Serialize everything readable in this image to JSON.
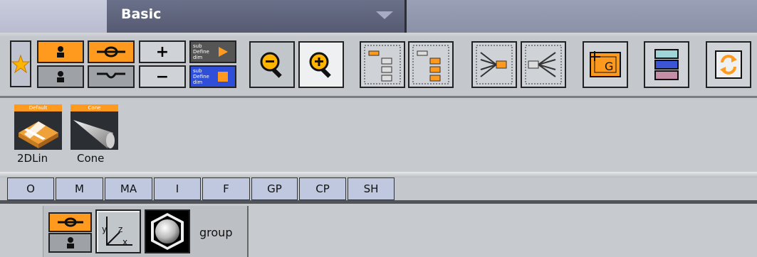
{
  "header": {
    "title": "Basic",
    "dropdown_icon": "chevron-down-icon"
  },
  "toolbar": {
    "favorites_icon": "star-icon",
    "group_buttons": {
      "add_group_icon": "add-group-icon",
      "remove_group_icon": "remove-group-icon",
      "add_transform_icon": "add-transform-icon",
      "remove_transform_icon": "remove-transform-icon",
      "expand_label": "+",
      "collapse_label": "−"
    },
    "sub_define_label_top": "sub Define dim",
    "sub_define_label_bottom": "sub Define dim",
    "zoom_out_icon": "zoom-out-icon",
    "zoom_in_icon": "zoom-in-icon",
    "tree_icons": [
      "tree-collapse-icon",
      "tree-expand-icon",
      "merge-icon",
      "split-icon"
    ],
    "group_icon_label": "G",
    "align_icon": "align-icon",
    "refresh_icon": "refresh-icon",
    "colors": {
      "accent_orange": "#ff9a1f",
      "accent_blue": "#2f4fd8",
      "header_dark": "#5b6078"
    }
  },
  "library": {
    "items": [
      {
        "tag": "Default",
        "label": "2DLin",
        "icon": "2d-line-icon"
      },
      {
        "tag": "Cone",
        "label": "Cone",
        "icon": "cone-icon"
      }
    ]
  },
  "tabs": [
    "O",
    "M",
    "MA",
    "I",
    "F",
    "GP",
    "CP",
    "SH"
  ],
  "tree": {
    "node_name": "group",
    "icons": [
      "group-toggle-icon",
      "transform-axis-icon",
      "sphere-geometry-icon"
    ],
    "axis_labels": {
      "y": "y",
      "z": "z",
      "x": "x"
    }
  }
}
